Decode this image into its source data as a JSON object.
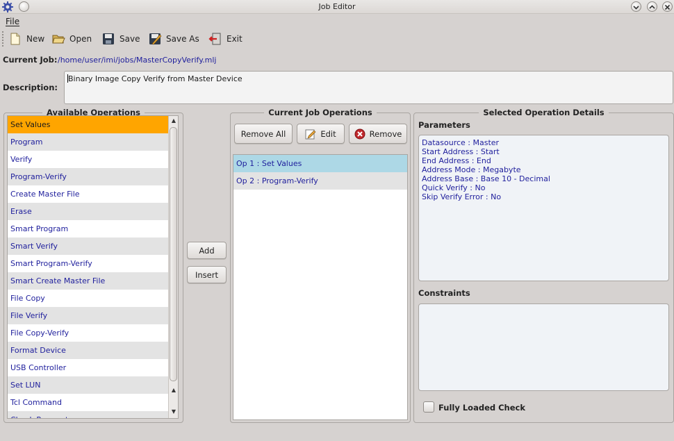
{
  "window": {
    "title": "Job Editor"
  },
  "menu": {
    "file_label": "File"
  },
  "toolbar": {
    "new_label": "New",
    "open_label": "Open",
    "save_label": "Save",
    "save_as_label": "Save As",
    "exit_label": "Exit"
  },
  "job": {
    "current_label": "Current Job:",
    "current_path": "/home/user/imi/jobs/MasterCopyVerify.mlj",
    "description_label": "Description:",
    "description_value": "Binary Image Copy Verify from Master Device"
  },
  "available": {
    "title": "Available Operations",
    "items": [
      "Set Values",
      "Program",
      "Verify",
      "Program-Verify",
      "Create Master File",
      "Erase",
      "Smart Program",
      "Smart Verify",
      "Smart Program-Verify",
      "Smart Create Master File",
      "File Copy",
      "File Verify",
      "File Copy-Verify",
      "Format Device",
      "USB Controller",
      "Set LUN",
      "Tcl Command",
      "Check Parameters"
    ],
    "selected_index": 0
  },
  "middle_buttons": {
    "add_label": "Add",
    "insert_label": "Insert"
  },
  "current_ops": {
    "title": "Current Job Operations",
    "remove_all_label": "Remove All",
    "edit_label": "Edit",
    "remove_label": "Remove",
    "items": [
      "Op 1 : Set Values",
      "Op 2 : Program-Verify"
    ],
    "selected_index": 0
  },
  "details": {
    "title": "Selected Operation Details",
    "parameters_label": "Parameters",
    "parameters": [
      "Datasource : Master",
      "Start Address : Start",
      "End Address : End",
      "Address Mode : Megabyte",
      "Address Base : Base 10 - Decimal",
      "Quick Verify : No",
      "Skip Verify Error : No"
    ],
    "constraints_label": "Constraints",
    "fully_loaded_label": "Fully Loaded Check",
    "fully_loaded_checked": false
  },
  "colors": {
    "selected_row": "#ffa500",
    "highlight_row": "#add8e6",
    "link_text": "#1e1e9c"
  },
  "icons": [
    "app-gear-icon",
    "minimize-icon",
    "maximize-icon",
    "close-icon",
    "new-file-icon",
    "open-folder-icon",
    "save-disk-icon",
    "save-as-icon",
    "exit-door-icon",
    "edit-pencil-icon",
    "remove-x-icon"
  ]
}
